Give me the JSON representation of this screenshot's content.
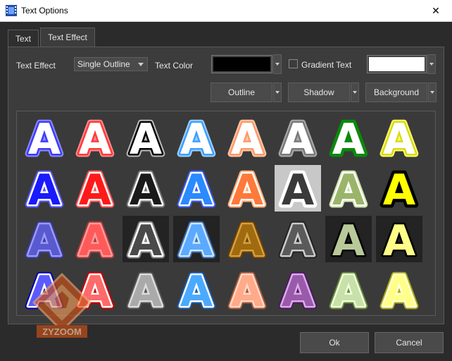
{
  "window": {
    "title": "Text Options",
    "close_glyph": "✕"
  },
  "tabs": [
    {
      "label": "Text",
      "active": false
    },
    {
      "label": "Text Effect",
      "active": true
    }
  ],
  "controls": {
    "text_effect_label": "Text Effect",
    "text_effect_value": "Single Outline",
    "text_color_label": "Text Color",
    "text_color": "#000000",
    "gradient_label": "Gradient Text",
    "gradient_checked": false,
    "gradient_color": "#ffffff",
    "outline_label": "Outline",
    "shadow_label": "Shadow",
    "background_label": "Background"
  },
  "presets": {
    "letter": "A",
    "selected_index": 13,
    "items": [
      {
        "fill": "#ffffff",
        "stroke": "#3d3dff",
        "glow": "#8a8aff",
        "bg": ""
      },
      {
        "fill": "#ffffff",
        "stroke": "#ff3b3b",
        "glow": "#ff8a8a",
        "bg": ""
      },
      {
        "fill": "#ffffff",
        "stroke": "#000000",
        "glow": "#bbbbbb",
        "bg": ""
      },
      {
        "fill": "#ffffff",
        "stroke": "#3ea0ff",
        "glow": "#9fd0ff",
        "bg": ""
      },
      {
        "fill": "#ffffff",
        "stroke": "#ff9a6a",
        "glow": "#ffc8a8",
        "bg": ""
      },
      {
        "fill": "#ffffff",
        "stroke": "#7a7a7a",
        "glow": "#aaaaaa",
        "bg": ""
      },
      {
        "fill": "#ffffff",
        "stroke": "#0a8a0a",
        "glow": "#0a8a0a",
        "bg": ""
      },
      {
        "fill": "#ffffff",
        "stroke": "#d9d91a",
        "glow": "#ffff66",
        "bg": ""
      },
      {
        "fill": "#1a1aff",
        "stroke": "#ffffff",
        "glow": "#5555ff",
        "bg": ""
      },
      {
        "fill": "#ff1a1a",
        "stroke": "#ffffff",
        "glow": "#ff5555",
        "bg": ""
      },
      {
        "fill": "#1a1a1a",
        "stroke": "#ffffff",
        "glow": "#777777",
        "bg": ""
      },
      {
        "fill": "#2a8aff",
        "stroke": "#ffffff",
        "glow": "#3a5aff",
        "bg": ""
      },
      {
        "fill": "#ff7a3a",
        "stroke": "#ffffff",
        "glow": "#ffaa77",
        "bg": ""
      },
      {
        "fill": "#3a3a3a",
        "stroke": "#ffffff",
        "glow": "#ffffff",
        "bg": "#c8c8c8"
      },
      {
        "fill": "#9ab56a",
        "stroke": "#ffffff",
        "glow": "#cde0aa",
        "bg": ""
      },
      {
        "fill": "#ffff00",
        "stroke": "#000000",
        "glow": "#000000",
        "bg": ""
      },
      {
        "fill": "#5a5acf",
        "stroke": "#9a9aff",
        "glow": "#3a3a9a",
        "bg": ""
      },
      {
        "fill": "#ff5a5a",
        "stroke": "#ff9a9a",
        "glow": "#aa3a3a",
        "bg": ""
      },
      {
        "fill": "#4a4a4a",
        "stroke": "#ffffff",
        "glow": "#888888",
        "bg": "#232323"
      },
      {
        "fill": "#5aaaff",
        "stroke": "#cfe6ff",
        "glow": "#3a6aaa",
        "bg": "#232323"
      },
      {
        "fill": "#a06a10",
        "stroke": "#d7a040",
        "glow": "#6a4000",
        "bg": ""
      },
      {
        "fill": "#5a5a5a",
        "stroke": "#cccccc",
        "glow": "#222222",
        "bg": ""
      },
      {
        "fill": "#b9c99a",
        "stroke": "#000000",
        "glow": "#222222",
        "bg": "#232323"
      },
      {
        "fill": "#ffff88",
        "stroke": "#000000",
        "glow": "#222222",
        "bg": "#232323"
      },
      {
        "fill": "#5a5aff",
        "stroke": "#ffffff",
        "glow": "#0000aa",
        "bg": ""
      },
      {
        "fill": "#ff6a6a",
        "stroke": "#ffffff",
        "glow": "#cc0000",
        "bg": ""
      },
      {
        "fill": "#aaaaaa",
        "stroke": "#dddddd",
        "glow": "#555555",
        "bg": ""
      },
      {
        "fill": "#4aaaff",
        "stroke": "#ffffff",
        "glow": "#1a5aaa",
        "bg": ""
      },
      {
        "fill": "#ffaa88",
        "stroke": "#ffd8c8",
        "glow": "#aa5a3a",
        "bg": ""
      },
      {
        "fill": "#9a5aaa",
        "stroke": "#ddaaee",
        "glow": "#4a1a5a",
        "bg": ""
      },
      {
        "fill": "#c8e0aa",
        "stroke": "#eeffdd",
        "glow": "#6a8a3a",
        "bg": ""
      },
      {
        "fill": "#ffff88",
        "stroke": "#ffffdd",
        "glow": "#aaaa1a",
        "bg": ""
      }
    ]
  },
  "footer": {
    "ok_label": "Ok",
    "cancel_label": "Cancel"
  },
  "watermark": {
    "text": "ZYZOOM"
  }
}
